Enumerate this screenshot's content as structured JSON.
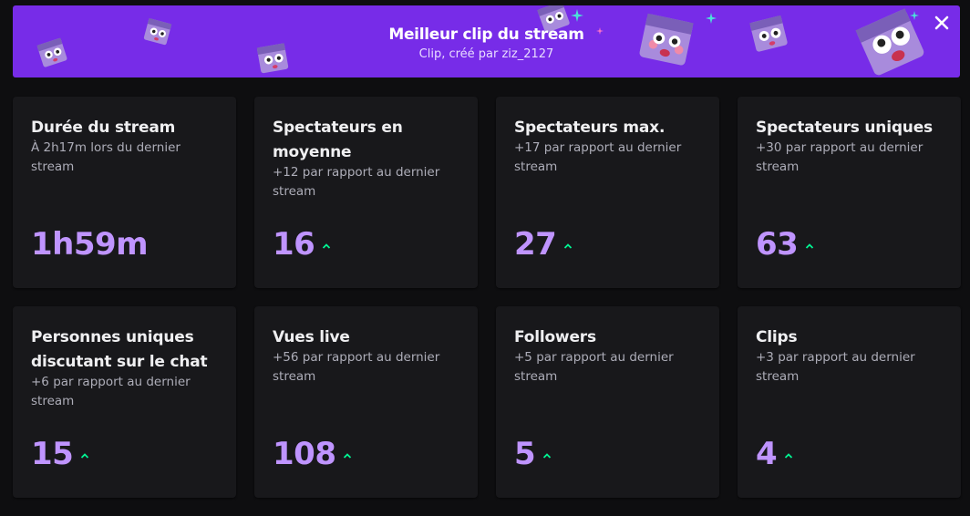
{
  "banner": {
    "title": "Meilleur clip du stream",
    "subtitle": "Clip, créé par ziz_2127",
    "close_icon": "close-icon",
    "background": "#772ce8"
  },
  "colors": {
    "value": "#bf94ff",
    "trend_up": "#00f593",
    "card_bg": "#18181b",
    "muted_text": "#adadb8"
  },
  "stats": [
    {
      "title": "Durée du stream",
      "subtitle": "À 2h17m lors du dernier stream",
      "value": "1h59m",
      "trend": "none"
    },
    {
      "title": "Spectateurs en moyenne",
      "subtitle": "+12 par rapport au dernier stream",
      "value": "16",
      "trend": "up"
    },
    {
      "title": "Spectateurs max.",
      "subtitle": "+17 par rapport au dernier stream",
      "value": "27",
      "trend": "up"
    },
    {
      "title": "Spectateurs uniques",
      "subtitle": "+30 par rapport au dernier stream",
      "value": "63",
      "trend": "up"
    },
    {
      "title": "Personnes uniques discutant sur le chat",
      "subtitle": "+6 par rapport au dernier stream",
      "value": "15",
      "trend": "up"
    },
    {
      "title": "Vues live",
      "subtitle": "+56 par rapport au dernier stream",
      "value": "108",
      "trend": "up"
    },
    {
      "title": "Followers",
      "subtitle": "+5 par rapport au dernier stream",
      "value": "5",
      "trend": "up"
    },
    {
      "title": "Clips",
      "subtitle": "+3 par rapport au dernier stream",
      "value": "4",
      "trend": "up"
    }
  ]
}
